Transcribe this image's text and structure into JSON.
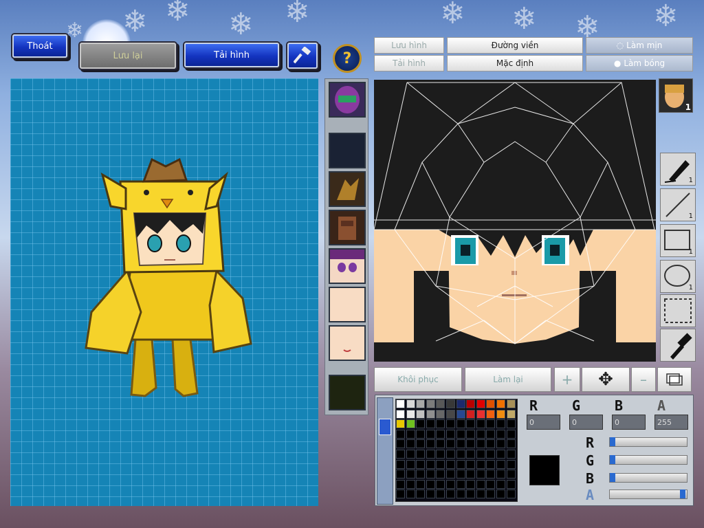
{
  "top_buttons": {
    "exit_label": "Thoát",
    "save_label": "Lưu lại",
    "reload_label": "Tải hình"
  },
  "toolbar": {
    "save_image": "Lưu hình",
    "load_image": "Tải hình",
    "outline": "Đường viền",
    "default": "Mặc định",
    "smooth": "Làm mịn",
    "shade": "Làm bóng"
  },
  "character_badge_count": "1",
  "tools": [
    {
      "name": "pen-tool",
      "count": "1"
    },
    {
      "name": "line-tool",
      "count": "1"
    },
    {
      "name": "rect-tool",
      "count": "1"
    },
    {
      "name": "ellipse-tool",
      "count": "1"
    },
    {
      "name": "select-tool",
      "count": ""
    },
    {
      "name": "eyedropper-tool",
      "count": ""
    }
  ],
  "actions": {
    "restore": "Khôi phục",
    "redo": "Làm lại"
  },
  "palette": {
    "row1": [
      "#ffffff",
      "#d8d8d8",
      "#a8a8a8",
      "#7c7c7c",
      "#585858",
      "#383838",
      "#1c2a6c",
      "#b80000",
      "#e00000",
      "#e05000",
      "#f07000",
      "#a89058"
    ],
    "row2": [
      "#ffffff",
      "#e8e8e8",
      "#c0c0c0",
      "#909090",
      "#686868",
      "#484848",
      "#284890",
      "#d02020",
      "#e83030",
      "#f06010",
      "#f08c10",
      "#c0a868"
    ],
    "row3": [
      "#e8c800",
      "#70c020"
    ],
    "current_color": "#000000"
  },
  "color_values": {
    "r_label": "R",
    "g_label": "G",
    "b_label": "B",
    "a_label": "A",
    "r": "0",
    "g": "0",
    "b": "0",
    "a": "255"
  },
  "colors": {
    "preview_bg": "#1584b6",
    "button_blue": "#1434c0",
    "canvas_bg": "#1c1c1c",
    "skin": "#fad3a6",
    "hair": "#1e1e1e"
  }
}
